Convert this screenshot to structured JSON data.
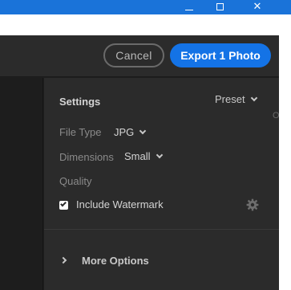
{
  "window": {
    "minimize_glyph": "",
    "close_glyph": "✕"
  },
  "header": {
    "cancel_label": "Cancel",
    "export_label": "Export 1 Photo"
  },
  "settings": {
    "title": "Settings",
    "preset_label": "Preset",
    "file_type": {
      "label": "File Type",
      "value": "JPG"
    },
    "dimensions": {
      "label": "Dimensions",
      "value": "Small"
    },
    "quality": {
      "label": "Quality"
    },
    "watermark": {
      "label": "Include Watermark",
      "checked": true
    }
  },
  "more_options": {
    "label": "More Options"
  },
  "edge_fragment": "ONS",
  "colors": {
    "titlebar": "#1a73d9",
    "accent": "#1473e6",
    "panel": "#2b2b2b"
  }
}
